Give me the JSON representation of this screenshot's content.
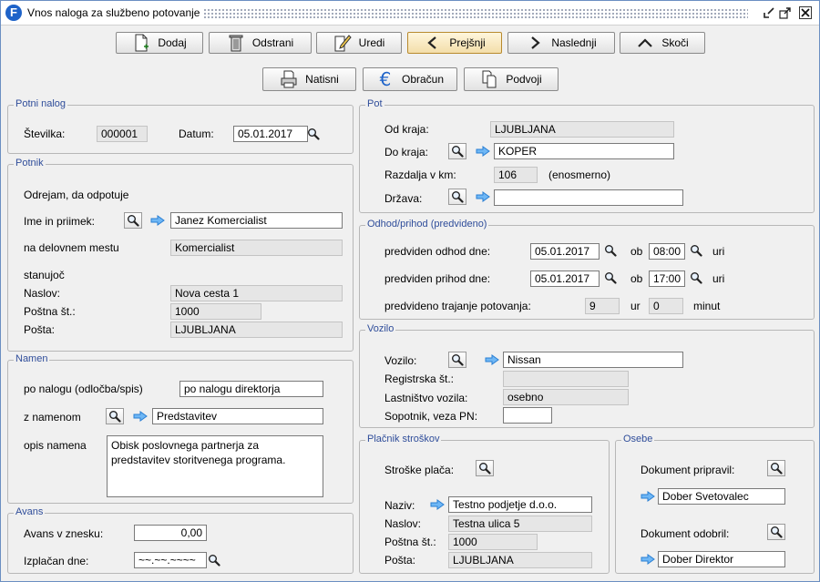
{
  "window": {
    "title": "Vnos naloga za službeno potovanje",
    "logo": "F"
  },
  "toolbar1": [
    {
      "label": "Dodaj",
      "icon": "document-add-icon"
    },
    {
      "label": "Odstrani",
      "icon": "trash-icon"
    },
    {
      "label": "Uredi",
      "icon": "edit-pencil-icon"
    },
    {
      "label": "Prejšnji",
      "icon": "chevron-left-icon"
    },
    {
      "label": "Naslednji",
      "icon": "chevron-right-icon"
    },
    {
      "label": "Skoči",
      "icon": "chevron-up-icon"
    }
  ],
  "toolbar2": [
    {
      "label": "Natisni",
      "icon": "print-icon"
    },
    {
      "label": "Obračun",
      "icon": "euro-icon"
    },
    {
      "label": "Podvoji",
      "icon": "copy-icon"
    }
  ],
  "potni_nalog": {
    "legend": "Potni nalog",
    "stevilka_label": "Številka:",
    "stevilka": "000001",
    "datum_label": "Datum:",
    "datum": "05.01.2017"
  },
  "potnik": {
    "legend": "Potnik",
    "intro": "Odrejam, da odpotuje",
    "ime_label": "Ime in priimek:",
    "ime": "Janez Komercialist",
    "mesto_label": "na delovnem mestu",
    "mesto": "Komercialist",
    "stanujoc": "stanujoč",
    "naslov_label": "Naslov:",
    "naslov": "Nova cesta 1",
    "postna_label": "Poštna št.:",
    "postna": "1000",
    "posta_label": "Pošta:",
    "posta": "LJUBLJANA"
  },
  "namen": {
    "legend": "Namen",
    "nalog_label": "po nalogu (odločba/spis)",
    "nalog": "po nalogu direktorja",
    "z_namenom_label": "z namenom",
    "z_namenom": "Predstavitev",
    "opis_label": "opis namena",
    "opis": "Obisk poslovnega partnerja za predstavitev storitvenega programa."
  },
  "avans": {
    "legend": "Avans",
    "znesek_label": "Avans v znesku:",
    "znesek": "0,00",
    "izplacan_label": "Izplačan dne:",
    "izplacan": "~~.~~.~~~~"
  },
  "pot": {
    "legend": "Pot",
    "od_label": "Od kraja:",
    "od": "LJUBLJANA",
    "do_label": "Do kraja:",
    "do": "KOPER",
    "razdalja_label": "Razdalja v km:",
    "razdalja": "106",
    "enosmerno": "(enosmerno)",
    "drzava_label": "Država:",
    "drzava": ""
  },
  "odhod": {
    "legend": "Odhod/prihod (predvideno)",
    "odhod_label": "predviden odhod dne:",
    "odhod_datum": "05.01.2017",
    "ob": "ob",
    "odhod_ura": "08:00",
    "uri": "uri",
    "prihod_label": "predviden prihod dne:",
    "prihod_datum": "05.01.2017",
    "prihod_ura": "17:00",
    "trajanje_label": "predvideno trajanje potovanja:",
    "ur_val": "9",
    "ur": "ur",
    "min_val": "0",
    "minut": "minut"
  },
  "vozilo": {
    "legend": "Vozilo",
    "vozilo_label": "Vozilo:",
    "vozilo": "Nissan",
    "reg_label": "Registrska št.:",
    "reg": "",
    "last_label": "Lastništvo vozila:",
    "last": "osebno",
    "sopotnik_label": "Sopotnik, veza PN:",
    "sopotnik": ""
  },
  "placnik": {
    "legend": "Plačnik stroškov",
    "placa_label": "Stroške plača:",
    "naziv_label": "Naziv:",
    "naziv": "Testno podjetje d.o.o.",
    "naslov_label": "Naslov:",
    "naslov": "Testna ulica 5",
    "postna_label": "Poštna št.:",
    "postna": "1000",
    "posta_label": "Pošta:",
    "posta": "LJUBLJANA"
  },
  "osebe": {
    "legend": "Osebe",
    "pripravil_label": "Dokument pripravil:",
    "pripravil": "Dober Svetovalec",
    "odobril_label": "Dokument odobril:",
    "odobril": "Dober Direktor"
  }
}
